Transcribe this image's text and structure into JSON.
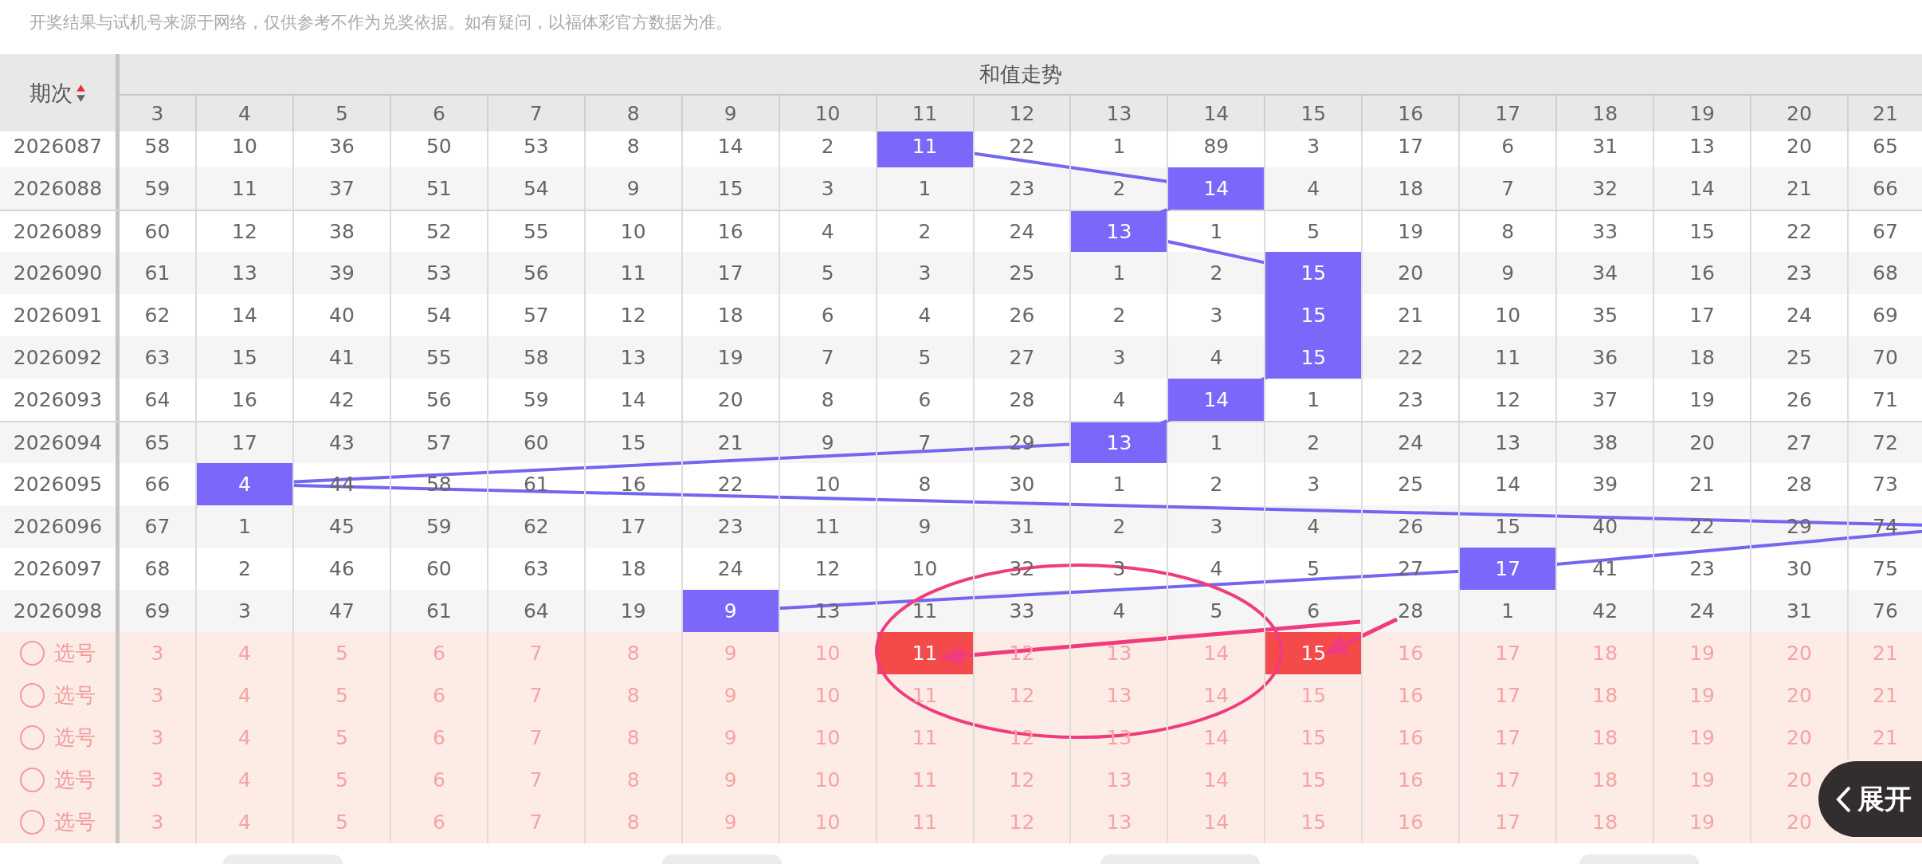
{
  "notice": "开奖结果与试机号来源于网络，仅供参考不作为兑奖依据。如有疑问，以福体彩官方数据为准。",
  "header": {
    "period_label": "期次",
    "group_title": "和值走势",
    "columns": [
      "3",
      "4",
      "5",
      "6",
      "7",
      "8",
      "9",
      "10",
      "11",
      "12",
      "13",
      "14",
      "15",
      "16",
      "17",
      "18",
      "19",
      "20",
      "21"
    ]
  },
  "rows": [
    {
      "period": "2026087",
      "cells": [
        {
          "v": "58",
          "hit": false
        },
        {
          "v": "10",
          "hit": false
        },
        {
          "v": "36",
          "hit": false
        },
        {
          "v": "50",
          "hit": false
        },
        {
          "v": "53",
          "hit": false
        },
        {
          "v": "8",
          "hit": false
        },
        {
          "v": "14",
          "hit": false
        },
        {
          "v": "2",
          "hit": false
        },
        {
          "v": "11",
          "hit": true
        },
        {
          "v": "22",
          "hit": false
        },
        {
          "v": "1",
          "hit": false
        },
        {
          "v": "89",
          "hit": false
        },
        {
          "v": "3",
          "hit": false
        },
        {
          "v": "17",
          "hit": false
        },
        {
          "v": "6",
          "hit": false
        },
        {
          "v": "31",
          "hit": false
        },
        {
          "v": "13",
          "hit": false
        },
        {
          "v": "20",
          "hit": false
        },
        {
          "v": "65",
          "hit": false
        }
      ]
    },
    {
      "period": "2026088",
      "cells": [
        {
          "v": "59",
          "hit": false
        },
        {
          "v": "11",
          "hit": false
        },
        {
          "v": "37",
          "hit": false
        },
        {
          "v": "51",
          "hit": false
        },
        {
          "v": "54",
          "hit": false
        },
        {
          "v": "9",
          "hit": false
        },
        {
          "v": "15",
          "hit": false
        },
        {
          "v": "3",
          "hit": false
        },
        {
          "v": "1",
          "hit": false
        },
        {
          "v": "23",
          "hit": false
        },
        {
          "v": "2",
          "hit": false
        },
        {
          "v": "14",
          "hit": true
        },
        {
          "v": "4",
          "hit": false
        },
        {
          "v": "18",
          "hit": false
        },
        {
          "v": "7",
          "hit": false
        },
        {
          "v": "32",
          "hit": false
        },
        {
          "v": "14",
          "hit": false
        },
        {
          "v": "21",
          "hit": false
        },
        {
          "v": "66",
          "hit": false
        }
      ]
    },
    {
      "period": "2026089",
      "cells": [
        {
          "v": "60",
          "hit": false
        },
        {
          "v": "12",
          "hit": false
        },
        {
          "v": "38",
          "hit": false
        },
        {
          "v": "52",
          "hit": false
        },
        {
          "v": "55",
          "hit": false
        },
        {
          "v": "10",
          "hit": false
        },
        {
          "v": "16",
          "hit": false
        },
        {
          "v": "4",
          "hit": false
        },
        {
          "v": "2",
          "hit": false
        },
        {
          "v": "24",
          "hit": false
        },
        {
          "v": "13",
          "hit": true
        },
        {
          "v": "1",
          "hit": false
        },
        {
          "v": "5",
          "hit": false
        },
        {
          "v": "19",
          "hit": false
        },
        {
          "v": "8",
          "hit": false
        },
        {
          "v": "33",
          "hit": false
        },
        {
          "v": "15",
          "hit": false
        },
        {
          "v": "22",
          "hit": false
        },
        {
          "v": "67",
          "hit": false
        }
      ]
    },
    {
      "period": "2026090",
      "cells": [
        {
          "v": "61",
          "hit": false
        },
        {
          "v": "13",
          "hit": false
        },
        {
          "v": "39",
          "hit": false
        },
        {
          "v": "53",
          "hit": false
        },
        {
          "v": "56",
          "hit": false
        },
        {
          "v": "11",
          "hit": false
        },
        {
          "v": "17",
          "hit": false
        },
        {
          "v": "5",
          "hit": false
        },
        {
          "v": "3",
          "hit": false
        },
        {
          "v": "25",
          "hit": false
        },
        {
          "v": "1",
          "hit": false
        },
        {
          "v": "2",
          "hit": false
        },
        {
          "v": "15",
          "hit": true
        },
        {
          "v": "20",
          "hit": false
        },
        {
          "v": "9",
          "hit": false
        },
        {
          "v": "34",
          "hit": false
        },
        {
          "v": "16",
          "hit": false
        },
        {
          "v": "23",
          "hit": false
        },
        {
          "v": "68",
          "hit": false
        }
      ]
    },
    {
      "period": "2026091",
      "cells": [
        {
          "v": "62",
          "hit": false
        },
        {
          "v": "14",
          "hit": false
        },
        {
          "v": "40",
          "hit": false
        },
        {
          "v": "54",
          "hit": false
        },
        {
          "v": "57",
          "hit": false
        },
        {
          "v": "12",
          "hit": false
        },
        {
          "v": "18",
          "hit": false
        },
        {
          "v": "6",
          "hit": false
        },
        {
          "v": "4",
          "hit": false
        },
        {
          "v": "26",
          "hit": false
        },
        {
          "v": "2",
          "hit": false
        },
        {
          "v": "3",
          "hit": false
        },
        {
          "v": "15",
          "hit": true
        },
        {
          "v": "21",
          "hit": false
        },
        {
          "v": "10",
          "hit": false
        },
        {
          "v": "35",
          "hit": false
        },
        {
          "v": "17",
          "hit": false
        },
        {
          "v": "24",
          "hit": false
        },
        {
          "v": "69",
          "hit": false
        }
      ]
    },
    {
      "period": "2026092",
      "cells": [
        {
          "v": "63",
          "hit": false
        },
        {
          "v": "15",
          "hit": false
        },
        {
          "v": "41",
          "hit": false
        },
        {
          "v": "55",
          "hit": false
        },
        {
          "v": "58",
          "hit": false
        },
        {
          "v": "13",
          "hit": false
        },
        {
          "v": "19",
          "hit": false
        },
        {
          "v": "7",
          "hit": false
        },
        {
          "v": "5",
          "hit": false
        },
        {
          "v": "27",
          "hit": false
        },
        {
          "v": "3",
          "hit": false
        },
        {
          "v": "4",
          "hit": false
        },
        {
          "v": "15",
          "hit": true
        },
        {
          "v": "22",
          "hit": false
        },
        {
          "v": "11",
          "hit": false
        },
        {
          "v": "36",
          "hit": false
        },
        {
          "v": "18",
          "hit": false
        },
        {
          "v": "25",
          "hit": false
        },
        {
          "v": "70",
          "hit": false
        }
      ]
    },
    {
      "period": "2026093",
      "cells": [
        {
          "v": "64",
          "hit": false
        },
        {
          "v": "16",
          "hit": false
        },
        {
          "v": "42",
          "hit": false
        },
        {
          "v": "56",
          "hit": false
        },
        {
          "v": "59",
          "hit": false
        },
        {
          "v": "14",
          "hit": false
        },
        {
          "v": "20",
          "hit": false
        },
        {
          "v": "8",
          "hit": false
        },
        {
          "v": "6",
          "hit": false
        },
        {
          "v": "28",
          "hit": false
        },
        {
          "v": "4",
          "hit": false
        },
        {
          "v": "14",
          "hit": true
        },
        {
          "v": "1",
          "hit": false
        },
        {
          "v": "23",
          "hit": false
        },
        {
          "v": "12",
          "hit": false
        },
        {
          "v": "37",
          "hit": false
        },
        {
          "v": "19",
          "hit": false
        },
        {
          "v": "26",
          "hit": false
        },
        {
          "v": "71",
          "hit": false
        }
      ]
    },
    {
      "period": "2026094",
      "cells": [
        {
          "v": "65",
          "hit": false
        },
        {
          "v": "17",
          "hit": false
        },
        {
          "v": "43",
          "hit": false
        },
        {
          "v": "57",
          "hit": false
        },
        {
          "v": "60",
          "hit": false
        },
        {
          "v": "15",
          "hit": false
        },
        {
          "v": "21",
          "hit": false
        },
        {
          "v": "9",
          "hit": false
        },
        {
          "v": "7",
          "hit": false
        },
        {
          "v": "29",
          "hit": false
        },
        {
          "v": "13",
          "hit": true
        },
        {
          "v": "1",
          "hit": false
        },
        {
          "v": "2",
          "hit": false
        },
        {
          "v": "24",
          "hit": false
        },
        {
          "v": "13",
          "hit": false
        },
        {
          "v": "38",
          "hit": false
        },
        {
          "v": "20",
          "hit": false
        },
        {
          "v": "27",
          "hit": false
        },
        {
          "v": "72",
          "hit": false
        }
      ]
    },
    {
      "period": "2026095",
      "cells": [
        {
          "v": "66",
          "hit": false
        },
        {
          "v": "4",
          "hit": true
        },
        {
          "v": "44",
          "hit": false
        },
        {
          "v": "58",
          "hit": false
        },
        {
          "v": "61",
          "hit": false
        },
        {
          "v": "16",
          "hit": false
        },
        {
          "v": "22",
          "hit": false
        },
        {
          "v": "10",
          "hit": false
        },
        {
          "v": "8",
          "hit": false
        },
        {
          "v": "30",
          "hit": false
        },
        {
          "v": "1",
          "hit": false
        },
        {
          "v": "2",
          "hit": false
        },
        {
          "v": "3",
          "hit": false
        },
        {
          "v": "25",
          "hit": false
        },
        {
          "v": "14",
          "hit": false
        },
        {
          "v": "39",
          "hit": false
        },
        {
          "v": "21",
          "hit": false
        },
        {
          "v": "28",
          "hit": false
        },
        {
          "v": "73",
          "hit": false
        }
      ]
    },
    {
      "period": "2026096",
      "cells": [
        {
          "v": "67",
          "hit": false
        },
        {
          "v": "1",
          "hit": false
        },
        {
          "v": "45",
          "hit": false
        },
        {
          "v": "59",
          "hit": false
        },
        {
          "v": "62",
          "hit": false
        },
        {
          "v": "17",
          "hit": false
        },
        {
          "v": "23",
          "hit": false
        },
        {
          "v": "11",
          "hit": false
        },
        {
          "v": "9",
          "hit": false
        },
        {
          "v": "31",
          "hit": false
        },
        {
          "v": "2",
          "hit": false
        },
        {
          "v": "3",
          "hit": false
        },
        {
          "v": "4",
          "hit": false
        },
        {
          "v": "26",
          "hit": false
        },
        {
          "v": "15",
          "hit": false
        },
        {
          "v": "40",
          "hit": false
        },
        {
          "v": "22",
          "hit": false
        },
        {
          "v": "29",
          "hit": false
        },
        {
          "v": "74",
          "hit": false
        }
      ]
    },
    {
      "period": "2026097",
      "cells": [
        {
          "v": "68",
          "hit": false
        },
        {
          "v": "2",
          "hit": false
        },
        {
          "v": "46",
          "hit": false
        },
        {
          "v": "60",
          "hit": false
        },
        {
          "v": "63",
          "hit": false
        },
        {
          "v": "18",
          "hit": false
        },
        {
          "v": "24",
          "hit": false
        },
        {
          "v": "12",
          "hit": false
        },
        {
          "v": "10",
          "hit": false
        },
        {
          "v": "32",
          "hit": false
        },
        {
          "v": "3",
          "hit": false
        },
        {
          "v": "4",
          "hit": false
        },
        {
          "v": "5",
          "hit": false
        },
        {
          "v": "27",
          "hit": false
        },
        {
          "v": "17",
          "hit": true
        },
        {
          "v": "41",
          "hit": false
        },
        {
          "v": "23",
          "hit": false
        },
        {
          "v": "30",
          "hit": false
        },
        {
          "v": "75",
          "hit": false
        }
      ]
    },
    {
      "period": "2026098",
      "cells": [
        {
          "v": "69",
          "hit": false
        },
        {
          "v": "3",
          "hit": false
        },
        {
          "v": "47",
          "hit": false
        },
        {
          "v": "61",
          "hit": false
        },
        {
          "v": "64",
          "hit": false
        },
        {
          "v": "19",
          "hit": false
        },
        {
          "v": "9",
          "hit": true
        },
        {
          "v": "13",
          "hit": false
        },
        {
          "v": "11",
          "hit": false
        },
        {
          "v": "33",
          "hit": false
        },
        {
          "v": "4",
          "hit": false
        },
        {
          "v": "5",
          "hit": false
        },
        {
          "v": "6",
          "hit": false
        },
        {
          "v": "28",
          "hit": false
        },
        {
          "v": "1",
          "hit": false
        },
        {
          "v": "42",
          "hit": false
        },
        {
          "v": "24",
          "hit": false
        },
        {
          "v": "31",
          "hit": false
        },
        {
          "v": "76",
          "hit": false
        }
      ]
    }
  ],
  "pick_rows": [
    {
      "label": "选号",
      "checked": false,
      "cells": [
        {
          "v": "3",
          "selected": false
        },
        {
          "v": "4",
          "selected": false
        },
        {
          "v": "5",
          "selected": false
        },
        {
          "v": "6",
          "selected": false
        },
        {
          "v": "7",
          "selected": false
        },
        {
          "v": "8",
          "selected": false
        },
        {
          "v": "9",
          "selected": false
        },
        {
          "v": "10",
          "selected": false
        },
        {
          "v": "11",
          "selected": true
        },
        {
          "v": "12",
          "selected": false
        },
        {
          "v": "13",
          "selected": false
        },
        {
          "v": "14",
          "selected": false
        },
        {
          "v": "15",
          "selected": true
        },
        {
          "v": "16",
          "selected": false
        },
        {
          "v": "17",
          "selected": false
        },
        {
          "v": "18",
          "selected": false
        },
        {
          "v": "19",
          "selected": false
        },
        {
          "v": "20",
          "selected": false
        },
        {
          "v": "21",
          "selected": false
        }
      ]
    },
    {
      "label": "选号",
      "checked": false,
      "cells": [
        {
          "v": "3",
          "selected": false
        },
        {
          "v": "4",
          "selected": false
        },
        {
          "v": "5",
          "selected": false
        },
        {
          "v": "6",
          "selected": false
        },
        {
          "v": "7",
          "selected": false
        },
        {
          "v": "8",
          "selected": false
        },
        {
          "v": "9",
          "selected": false
        },
        {
          "v": "10",
          "selected": false
        },
        {
          "v": "11",
          "selected": false
        },
        {
          "v": "12",
          "selected": false
        },
        {
          "v": "13",
          "selected": false
        },
        {
          "v": "14",
          "selected": false
        },
        {
          "v": "15",
          "selected": false
        },
        {
          "v": "16",
          "selected": false
        },
        {
          "v": "17",
          "selected": false
        },
        {
          "v": "18",
          "selected": false
        },
        {
          "v": "19",
          "selected": false
        },
        {
          "v": "20",
          "selected": false
        },
        {
          "v": "21",
          "selected": false
        }
      ]
    },
    {
      "label": "选号",
      "checked": false,
      "cells": [
        {
          "v": "3",
          "selected": false
        },
        {
          "v": "4",
          "selected": false
        },
        {
          "v": "5",
          "selected": false
        },
        {
          "v": "6",
          "selected": false
        },
        {
          "v": "7",
          "selected": false
        },
        {
          "v": "8",
          "selected": false
        },
        {
          "v": "9",
          "selected": false
        },
        {
          "v": "10",
          "selected": false
        },
        {
          "v": "11",
          "selected": false
        },
        {
          "v": "12",
          "selected": false
        },
        {
          "v": "13",
          "selected": false
        },
        {
          "v": "14",
          "selected": false
        },
        {
          "v": "15",
          "selected": false
        },
        {
          "v": "16",
          "selected": false
        },
        {
          "v": "17",
          "selected": false
        },
        {
          "v": "18",
          "selected": false
        },
        {
          "v": "19",
          "selected": false
        },
        {
          "v": "20",
          "selected": false
        },
        {
          "v": "21",
          "selected": false
        }
      ]
    },
    {
      "label": "选号",
      "checked": false,
      "cells": [
        {
          "v": "3",
          "selected": false
        },
        {
          "v": "4",
          "selected": false
        },
        {
          "v": "5",
          "selected": false
        },
        {
          "v": "6",
          "selected": false
        },
        {
          "v": "7",
          "selected": false
        },
        {
          "v": "8",
          "selected": false
        },
        {
          "v": "9",
          "selected": false
        },
        {
          "v": "10",
          "selected": false
        },
        {
          "v": "11",
          "selected": false
        },
        {
          "v": "12",
          "selected": false
        },
        {
          "v": "13",
          "selected": false
        },
        {
          "v": "14",
          "selected": false
        },
        {
          "v": "15",
          "selected": false
        },
        {
          "v": "16",
          "selected": false
        },
        {
          "v": "17",
          "selected": false
        },
        {
          "v": "18",
          "selected": false
        },
        {
          "v": "19",
          "selected": false
        },
        {
          "v": "20",
          "selected": false
        }
      ]
    },
    {
      "label": "选号",
      "checked": false,
      "cells": [
        {
          "v": "3",
          "selected": false
        },
        {
          "v": "4",
          "selected": false
        },
        {
          "v": "5",
          "selected": false
        },
        {
          "v": "6",
          "selected": false
        },
        {
          "v": "7",
          "selected": false
        },
        {
          "v": "8",
          "selected": false
        },
        {
          "v": "9",
          "selected": false
        },
        {
          "v": "10",
          "selected": false
        },
        {
          "v": "11",
          "selected": false
        },
        {
          "v": "12",
          "selected": false
        },
        {
          "v": "13",
          "selected": false
        },
        {
          "v": "14",
          "selected": false
        },
        {
          "v": "15",
          "selected": false
        },
        {
          "v": "16",
          "selected": false
        },
        {
          "v": "17",
          "selected": false
        },
        {
          "v": "18",
          "selected": false
        },
        {
          "v": "19",
          "selected": false
        },
        {
          "v": "20",
          "selected": false
        }
      ]
    }
  ],
  "expand_button": "展开"
}
